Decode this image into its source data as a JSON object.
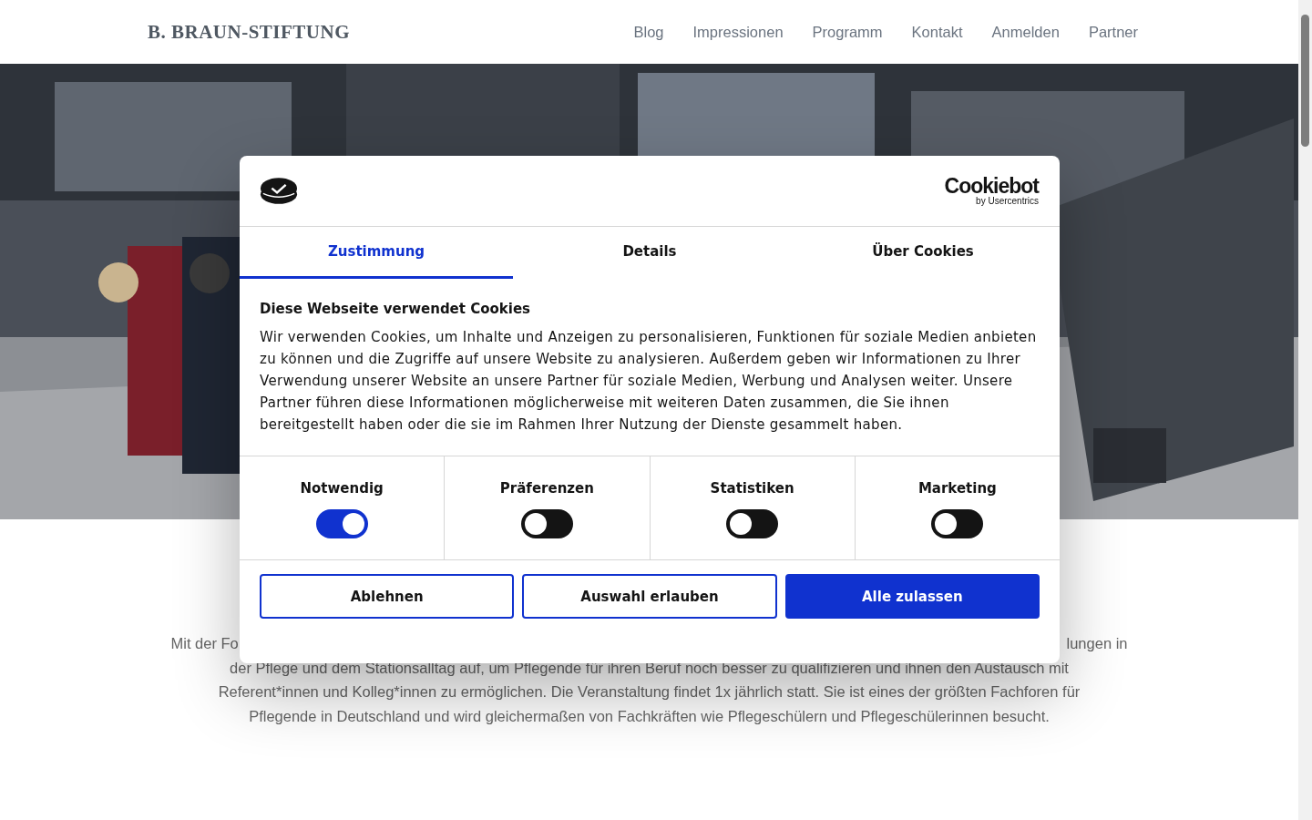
{
  "header": {
    "logo": "B. BRAUN-STIFTUNG",
    "nav": [
      "Blog",
      "Impressionen",
      "Programm",
      "Kontakt",
      "Anmelden",
      "Partner"
    ]
  },
  "hero": {
    "kind": "picture"
  },
  "intro_lines": [
    [
      "Mit der Fo",
      "lungen in"
    ],
    [
      "der Pflege und dem Stationsalltag auf, um Pflegende für ihren Beruf noch besser zu qualifizieren und ihnen den Austausch mit"
    ],
    [
      "Referent*innen und Kolleg*innen zu ermöglichen. Die Veranstaltung findet 1x jährlich statt. Sie ist eines der größten Fachforen für"
    ],
    [
      "Pflegende in Deutschland und wird gleichermaßen von Fachkräften wie Pflegeschülern und Pflegeschülerinnen besucht."
    ]
  ],
  "cookie_dialog": {
    "brand": "Cookiebot",
    "brand_sub": "by Usercentrics",
    "tabs": [
      {
        "label": "Zustimmung",
        "selected": true
      },
      {
        "label": "Details",
        "selected": false
      },
      {
        "label": "Über Cookies",
        "selected": false
      }
    ],
    "heading": "Diese Webseite verwendet Cookies",
    "text": "Wir verwenden Cookies, um Inhalte und Anzeigen zu personalisieren, Funktionen für soziale Medien anbieten zu können und die Zugriffe auf unsere Website zu analysieren. Außerdem geben wir Informationen zu Ihrer Verwendung unserer Website an unsere Partner für soziale Medien, Werbung und Analysen weiter. Unsere Partner führen diese Informationen möglicherweise mit weiteren Daten zusammen, die Sie ihnen bereitgestellt haben oder die sie im Rahmen Ihrer Nutzung der Dienste gesammelt haben.",
    "categories": [
      {
        "label": "Notwendig",
        "checked": true
      },
      {
        "label": "Präferenzen",
        "checked": false
      },
      {
        "label": "Statistiken",
        "checked": false
      },
      {
        "label": "Marketing",
        "checked": false
      }
    ],
    "buttons": [
      {
        "label": "Ablehnen",
        "kind": "outline"
      },
      {
        "label": "Auswahl erlauben",
        "kind": "outline"
      },
      {
        "label": "Alle zulassen",
        "kind": "primary"
      }
    ]
  }
}
